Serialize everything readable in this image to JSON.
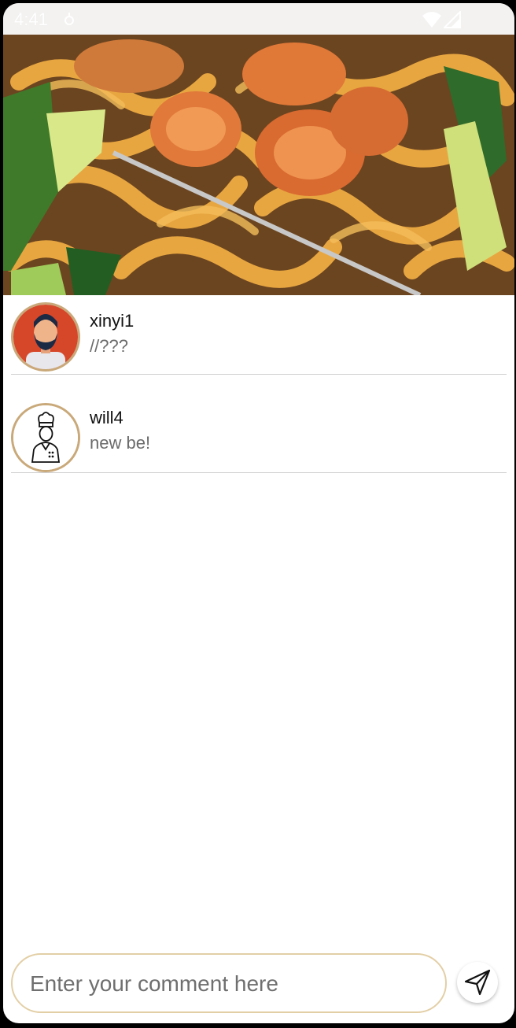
{
  "status_bar": {
    "time": "4:41",
    "icons": [
      "notification-icon",
      "wifi-icon",
      "signal-icon"
    ]
  },
  "hero_image": {
    "subject": "udon noodles with shrimp"
  },
  "comments": [
    {
      "username": "xinyi1",
      "text": "//???",
      "avatar": "bearded-man-avatar"
    },
    {
      "username": "will4",
      "text": "new be!",
      "avatar": "chef-avatar"
    }
  ],
  "composer": {
    "placeholder": "Enter your comment here",
    "value": "",
    "send_icon": "send-icon"
  },
  "colors": {
    "avatar_border": "#c9a97a",
    "input_border": "#e3cfa6",
    "divider": "#cfcfcf"
  }
}
